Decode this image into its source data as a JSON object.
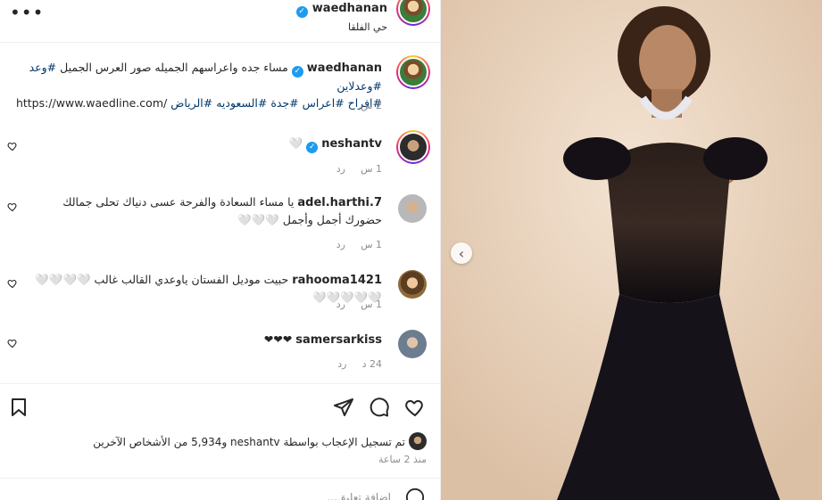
{
  "header": {
    "username": "waedhanan",
    "location": "حي الفلقا",
    "more_label": "•••"
  },
  "caption": {
    "username": "waedhanan",
    "text": "مساء جده واعراسهم الجميله صور العرس الجميل",
    "hashtags_line1": "#وعد #وعدلاين",
    "hashtags_line2": "#افراح #اعراس #جدة #السعوديه #الرياض",
    "url": "https://www.waedline.com/",
    "time": "2 س"
  },
  "comments": [
    {
      "username": "neshantv",
      "verified": true,
      "text": "🤍",
      "time": "1 س",
      "reply": "رد"
    },
    {
      "username": "adel.harthi.7",
      "verified": false,
      "text": "يا مساء السعادة والفرحة عسى دنياك تحلى جمالك حضورك أجمل وأجمل 🤍🤍🤍",
      "time": "1 س",
      "reply": "رد"
    },
    {
      "username": "rahooma1421",
      "verified": false,
      "text": "حبيت موديل الفستان ياوعدي القالب غالب 🤍🤍🤍🤍🤍🤍🤍🤍🤍",
      "time": "1 س",
      "reply": "رد"
    },
    {
      "username": "samersarkiss",
      "verified": false,
      "text": "❤❤❤",
      "time": "24 د",
      "reply": "رد"
    }
  ],
  "likes": {
    "text": "تم تسجيل الإعجاب بواسطة neshantv و5,934 من الأشخاص الآخرين",
    "time_ago": "منذ 2 ساعة"
  },
  "add_comment": {
    "placeholder": "إضافة تعليق..."
  },
  "icons": {
    "save": "bookmark-icon",
    "share": "paper-plane-icon",
    "comment": "speech-bubble-icon",
    "like": "heart-icon",
    "previous": "chevron-left-icon"
  },
  "colors": {
    "verified": "#1d9bf0",
    "link": "#00376b",
    "muted": "#8e8e8e"
  }
}
